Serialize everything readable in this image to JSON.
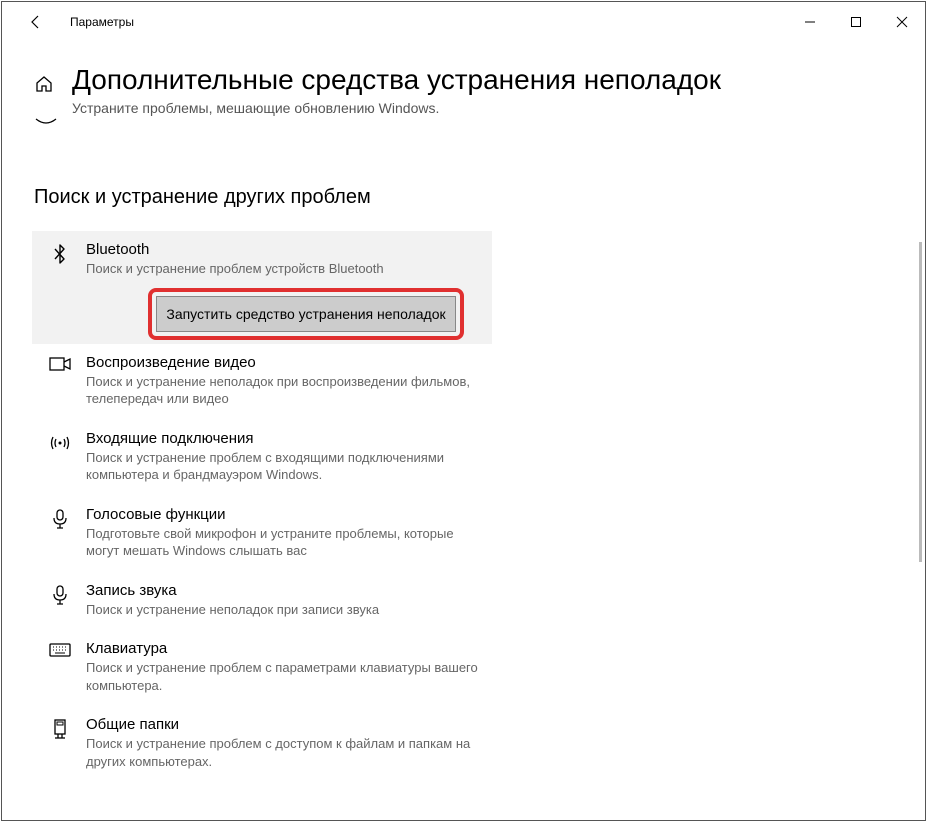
{
  "window_title": "Параметры",
  "page_title": "Дополнительные средства устранения неполадок",
  "page_subtitle": "Устраните проблемы, мешающие обновлению Windows.",
  "section_title": "Поиск и устранение других проблем",
  "run_button_label": "Запустить средство устранения неполадок",
  "troubleshooters": [
    {
      "name": "Bluetooth",
      "desc": "Поиск и устранение проблем устройств Bluetooth"
    },
    {
      "name": "Воспроизведение видео",
      "desc": "Поиск и устранение неполадок при воспроизведении фильмов, телепередач или видео"
    },
    {
      "name": "Входящие подключения",
      "desc": "Поиск и устранение проблем с входящими подключениями компьютера и брандмауэром Windows."
    },
    {
      "name": "Голосовые функции",
      "desc": "Подготовьте свой микрофон и устраните проблемы, которые могут мешать Windows слышать вас"
    },
    {
      "name": "Запись звука",
      "desc": "Поиск и устранение неполадок при записи звука"
    },
    {
      "name": "Клавиатура",
      "desc": "Поиск и устранение проблем с параметрами клавиатуры вашего компьютера."
    },
    {
      "name": "Общие папки",
      "desc": "Поиск и устранение проблем с доступом к файлам и папкам на других компьютерах."
    }
  ]
}
